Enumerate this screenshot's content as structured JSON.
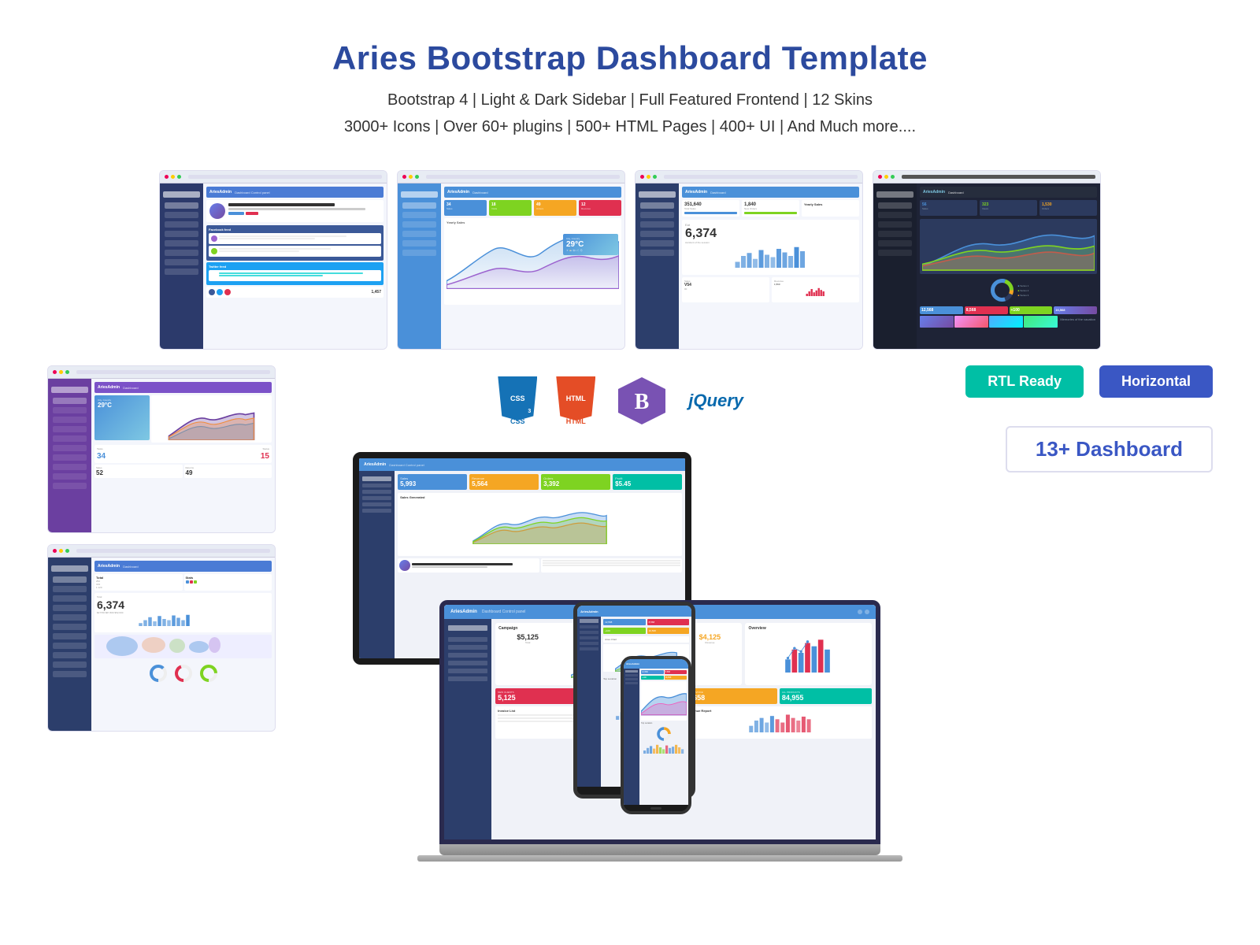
{
  "header": {
    "title": "Aries Bootstrap Dashboard Template",
    "subtitle1": "Bootstrap 4  |  Light & Dark Sidebar  |  Full Featured Frontend  |  12 Skins",
    "subtitle2": "3000+ Icons  |  Over 60+ plugins  |  500+ HTML Pages  |  400+ UI  |  And Much more...."
  },
  "tech": {
    "css3_label": "CSS",
    "css3_num": "3",
    "html5_label": "HTML",
    "html5_num": "5",
    "jquery_label": "jQuery",
    "bootstrap_symbol": "B"
  },
  "features": {
    "rtl_label": "RTL Ready",
    "horizontal_label": "Horizontal",
    "dashboard_count": "13+ Dashboard"
  },
  "screenshots": {
    "sc1_title": "Dashboard",
    "sc2_title": "Dashboard",
    "sc3_title": "Dashboard",
    "sc4_title": "Dashboard"
  },
  "stats": {
    "value1": "34",
    "value2": "18",
    "value3": "49",
    "value4": "12",
    "eat_value": "6,374",
    "eat_label": "Eat",
    "todos_value": "34",
    "status_value": "15",
    "val52": "52",
    "val49": "49",
    "val12568": "12,568",
    "val8568": "8,568",
    "val100": "+100",
    "val16568": "16,568",
    "val6374": "6,374"
  },
  "colors": {
    "primary_blue": "#4a90d9",
    "dark_blue": "#2c3e6b",
    "purple": "#7b52c8",
    "green": "#7ed321",
    "orange": "#f5a623",
    "red": "#e03050",
    "teal": "#00bfa5",
    "accent_blue": "#3a57c4",
    "title_blue": "#2c4a9e"
  }
}
